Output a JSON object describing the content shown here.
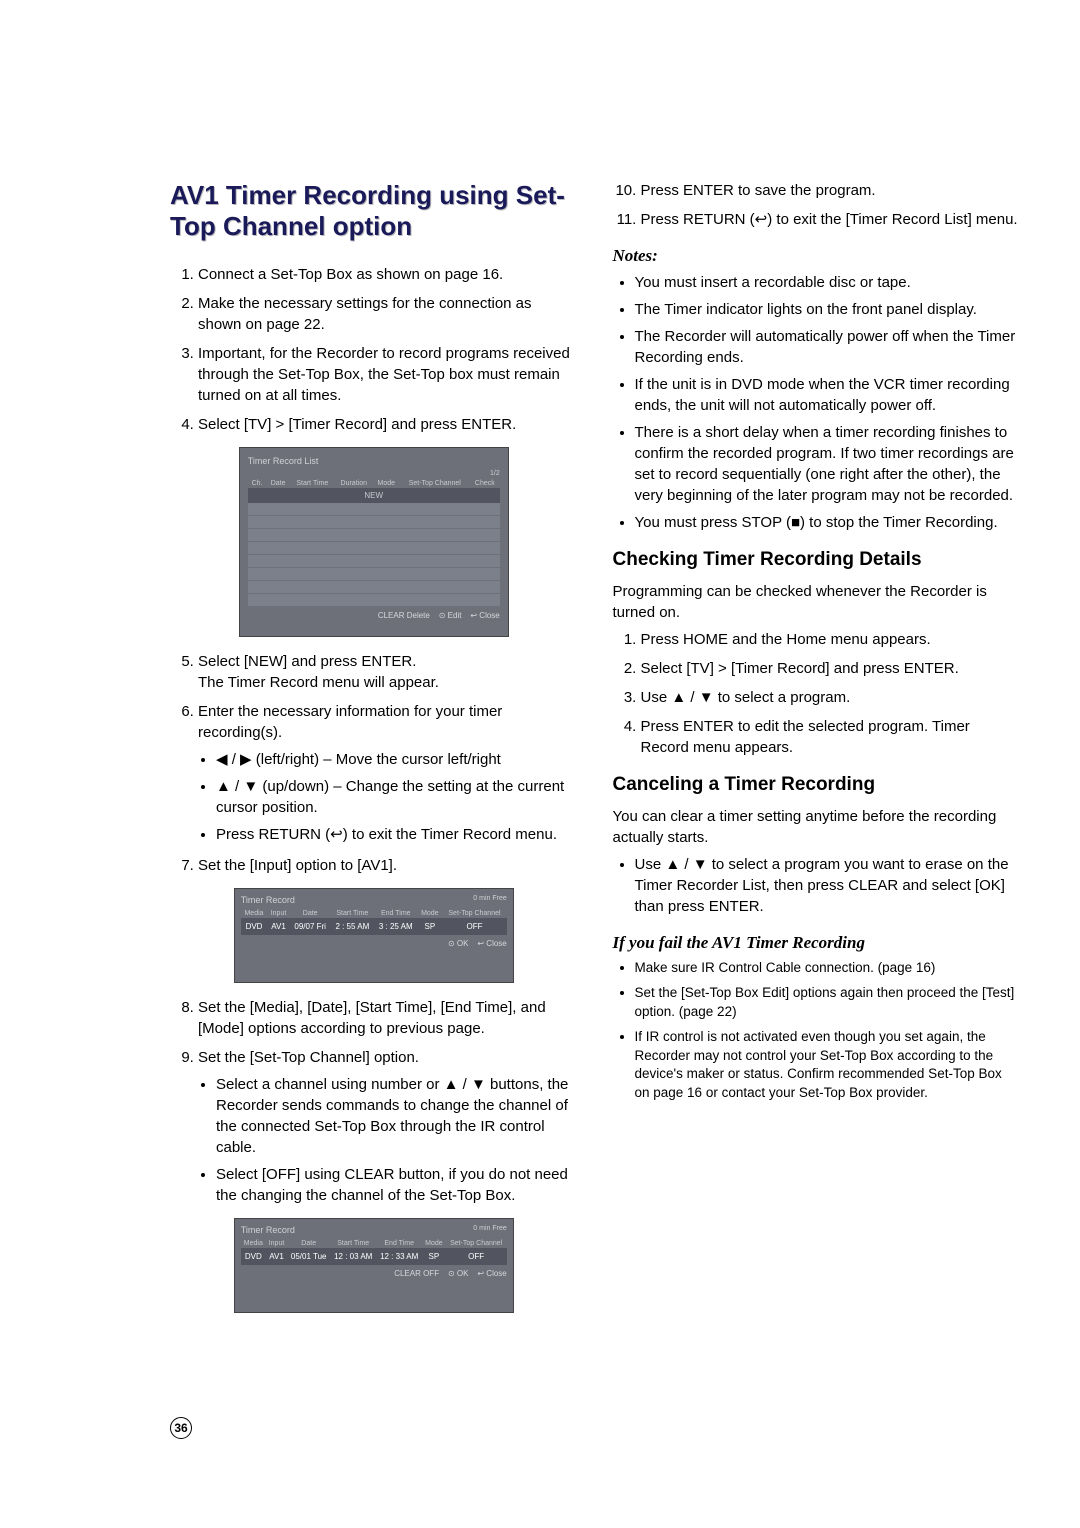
{
  "page_number": "36",
  "left": {
    "title": "AV1 Timer Recording using Set-Top Channel option",
    "step1": "Connect a Set-Top Box as shown on page 16.",
    "step2": "Make the necessary settings for the connection as shown on page 22.",
    "step3": "Important, for the Recorder to record programs received through the Set-Top Box, the Set-Top box must remain turned on at all times.",
    "step4": "Select [TV] > [Timer Record] and press ENTER.",
    "fig1": {
      "title": "Timer Record List",
      "page_ind": "1/2",
      "headers": [
        "Ch.",
        "Date",
        "Start Time",
        "Duration",
        "Mode",
        "Set-Top Channel",
        "Check"
      ],
      "new_label": "NEW",
      "footer_delete": "CLEAR Delete",
      "footer_edit": "⊙ Edit",
      "footer_close": "↩ Close"
    },
    "step5a": "Select [NEW] and press ENTER.",
    "step5b": "The Timer Record menu will appear.",
    "step6": "Enter the necessary information for your timer recording(s).",
    "step6_b1": "◀ / ▶ (left/right) – Move the cursor left/right",
    "step6_b2": "▲ / ▼ (up/down) – Change the setting at the current cursor position.",
    "step6_b3": "Press RETURN (↩) to exit the Timer Record menu.",
    "step7": "Set the [Input] option to [AV1].",
    "fig2": {
      "title": "Timer Record",
      "min_free": "0  min Free",
      "headers": [
        "Media",
        "Input",
        "Date",
        "Start Time",
        "End Time",
        "Mode",
        "Set-Top Channel"
      ],
      "row": [
        "DVD",
        "AV1",
        "09/07 Fri",
        "2 : 55 AM",
        "3 : 25 AM",
        "SP",
        "OFF"
      ],
      "footer_ok": "⊙ OK",
      "footer_close": "↩ Close"
    },
    "step8": "Set the [Media], [Date], [Start Time], [End Time], and [Mode] options according to previous page.",
    "step9": "Set the [Set-Top Channel] option.",
    "step9_b1": "Select a channel using number or ▲ / ▼ buttons, the Recorder sends commands to change the channel of the connected Set-Top Box through the IR control cable.",
    "step9_b2": "Select [OFF] using CLEAR button, if you do not need the changing the channel of the Set-Top Box.",
    "fig3": {
      "title": "Timer Record",
      "min_free": "0  min Free",
      "headers": [
        "Media",
        "Input",
        "Date",
        "Start Time",
        "End Time",
        "Mode",
        "Set-Top Channel"
      ],
      "row": [
        "DVD",
        "AV1",
        "05/01 Tue",
        "12 : 03 AM",
        "12 : 33 AM",
        "SP",
        "OFF"
      ],
      "footer_clear": "CLEAR OFF",
      "footer_ok": "⊙ OK",
      "footer_close": "↩ Close"
    }
  },
  "right": {
    "step10": "Press ENTER to save the program.",
    "step11": "Press RETURN (↩) to exit the [Timer Record List] menu.",
    "notes_head": "Notes:",
    "n1": "You must insert a recordable disc or tape.",
    "n2": "The Timer indicator lights on the front panel display.",
    "n3": "The Recorder will automatically power off when the Timer Recording ends.",
    "n4": "If the unit is in DVD mode when the VCR timer recording ends, the unit will not automatically power off.",
    "n5": "There is a short delay when a timer recording finishes to confirm the recorded program. If two timer recordings are set to record sequentially (one right after the other), the very beginning of the later program may not be recorded.",
    "n6": "You must press STOP (■) to stop the Timer Recording.",
    "check_head": "Checking Timer Recording Details",
    "check_intro": "Programming can be checked whenever the Recorder is turned on.",
    "c1": "Press HOME and the Home menu appears.",
    "c2": "Select [TV] > [Timer Record] and press ENTER.",
    "c3": "Use ▲ / ▼ to select a program.",
    "c4": "Press ENTER to edit the selected program. Timer Record menu appears.",
    "cancel_head": "Canceling a Timer Recording",
    "cancel_intro": "You can clear a timer setting anytime before the recording actually starts.",
    "cancel_b1": "Use ▲ / ▼ to select a program you want to erase on the Timer Recorder List, then press CLEAR and select [OK] than press ENTER.",
    "fail_head": "If you fail the AV1 Timer Recording",
    "f1": "Make sure IR Control Cable connection. (page 16)",
    "f2": "Set the [Set-Top Box Edit] options again then proceed the [Test] option. (page 22)",
    "f3": "If IR control is not activated even though you set again, the Recorder may not control your Set-Top Box according to the device's maker or status. Confirm recommended Set-Top Box on page 16 or contact your Set-Top Box provider."
  }
}
